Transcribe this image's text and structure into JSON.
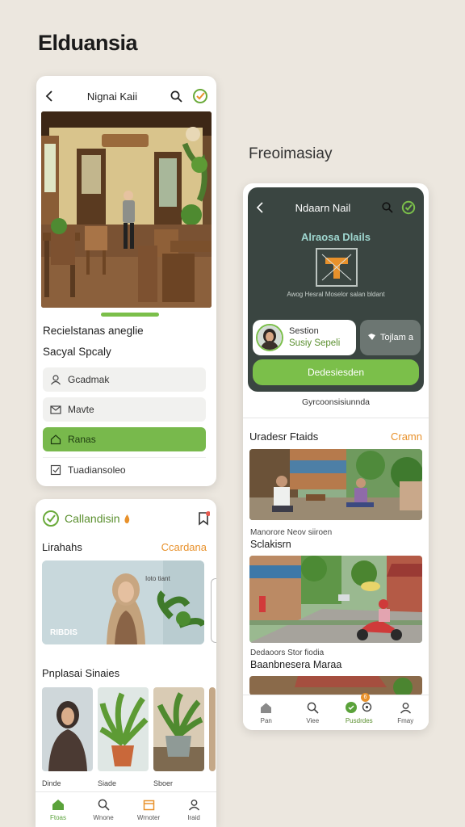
{
  "page": {
    "headline": "Elduansia",
    "subhead": "Freoimasiay"
  },
  "card1": {
    "title": "Nignai Kaii",
    "heading": "Recielstanas aneglie",
    "subheading": "Sacyal Spcaly",
    "menu": [
      {
        "label": "Gcadmak",
        "icon": "user-icon",
        "active": false
      },
      {
        "label": "Mavte",
        "icon": "mail-icon",
        "active": false
      },
      {
        "label": "Ranas",
        "icon": "home-icon",
        "active": true
      },
      {
        "label": "Tuadiansoleo",
        "icon": "checkbox-icon",
        "active": false
      }
    ],
    "pager_progress": 1
  },
  "card2": {
    "brand": "Callandisin",
    "section_title": "Lirahahs",
    "section_link": "Ccardana",
    "hero_label": "RIBDIS",
    "hero_tag": "Ioto tiant",
    "sec2_title": "Pnplasai Sinaies",
    "thumb_captions": [
      "Dinde",
      "Siade",
      "Sboer"
    ],
    "nav": [
      {
        "label": "Ftoas",
        "icon": "home-icon",
        "active": true
      },
      {
        "label": "Wnone",
        "icon": "search-icon",
        "active": false
      },
      {
        "label": "Wrnoter",
        "icon": "calendar-icon",
        "active": false
      },
      {
        "label": "Iraid",
        "icon": "user-icon",
        "active": false
      }
    ],
    "colors": {
      "accent": "#7bbf4a",
      "link": "#e8912b"
    }
  },
  "card3": {
    "title": "Ndaarn Nail",
    "dark_title": "Alraosa Dlails",
    "dark_caption": "Awog Hesral Moselor salan bldant",
    "profile_line1": "Sestion",
    "profile_line2": "Susiy Sepeli",
    "gray_pill": "Tojlam a",
    "green_button": "Dedesiesden",
    "note": "Gyrcoonsisiunnda",
    "section_title": "Uradesr Ftaids",
    "section_link": "Cramn",
    "item1_sub": "Manorore Neov siiroen",
    "item1_title": "Sclakisrn",
    "item2_sub": "Dedaoors Stor fiodia",
    "item2_title": "Baanbnesera Maraa",
    "nav": [
      {
        "label": "Pan",
        "icon": "home-icon",
        "active": false
      },
      {
        "label": "Viee",
        "icon": "search-icon",
        "active": false
      },
      {
        "label": "Pusdrdes",
        "icon": "chat-icon",
        "active": true
      },
      {
        "label": "Fmay",
        "icon": "user-icon",
        "active": false
      }
    ],
    "badge": "6",
    "colors": {
      "dark_panel": "#3a4541",
      "accent": "#7bbf4a",
      "link": "#e8912b"
    }
  }
}
